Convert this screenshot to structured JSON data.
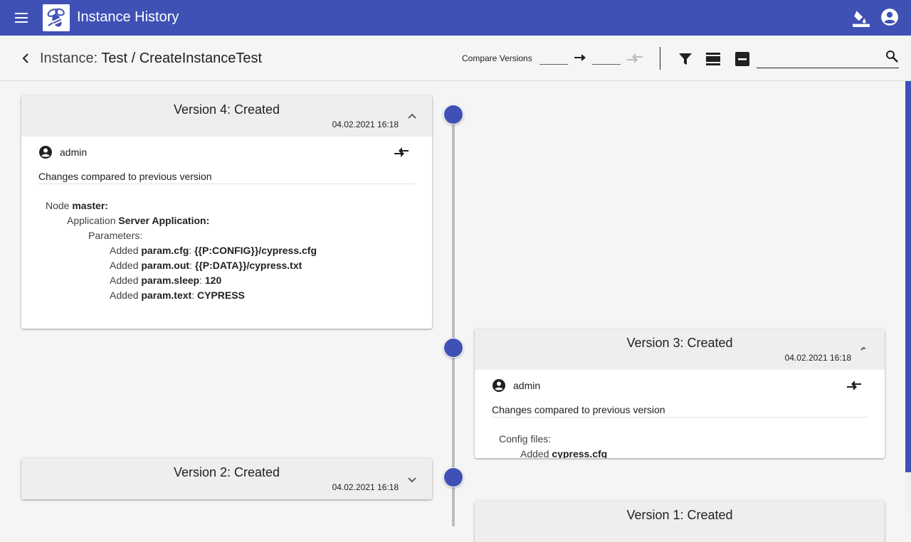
{
  "appbar": {
    "title": "Instance History",
    "icons": [
      "menu-icon",
      "bee-logo",
      "format-paint-icon",
      "account-circle-icon"
    ]
  },
  "subbar": {
    "crumb_prefix": "Instance:",
    "crumb_path": "Test / CreateInstanceTest",
    "compare_label": "Compare Versions",
    "compare_from": "",
    "compare_to": "",
    "search_placeholder": "",
    "icons": [
      "back-icon",
      "arrow-right-icon",
      "compare-icon",
      "filter-icon",
      "view-density-icon",
      "collapse-all-icon",
      "search-icon"
    ]
  },
  "colors": {
    "primary": "#3f51b5",
    "timeline": "#bdbdbd",
    "card_header": "#eeeeee"
  },
  "versions": [
    {
      "title": "Version 4: Created",
      "date": "04.02.2021 16:18",
      "expanded": true,
      "user": "admin",
      "changes_label": "Changes compared to previous version",
      "node_prefix": "Node",
      "node_name": "master:",
      "app_prefix": "Application",
      "app_name": "Server Application:",
      "params_label": "Parameters:",
      "params": [
        {
          "action": "Added",
          "key": "param.cfg",
          "value": "{{P:CONFIG}}/cypress.cfg"
        },
        {
          "action": "Added",
          "key": "param.out",
          "value": "{{P:DATA}}/cypress.txt"
        },
        {
          "action": "Added",
          "key": "param.sleep",
          "value": "120"
        },
        {
          "action": "Added",
          "key": "param.text",
          "value": "CYPRESS"
        }
      ]
    },
    {
      "title": "Version 3: Created",
      "date": "04.02.2021 16:18",
      "expanded": true,
      "user": "admin",
      "changes_label": "Changes compared to previous version",
      "config_label": "Config files:",
      "config_action": "Added",
      "config_file": "cypress.cfg"
    },
    {
      "title": "Version 2: Created",
      "date": "04.02.2021 16:18",
      "expanded": false
    },
    {
      "title": "Version 1: Created",
      "expanded": false
    }
  ]
}
